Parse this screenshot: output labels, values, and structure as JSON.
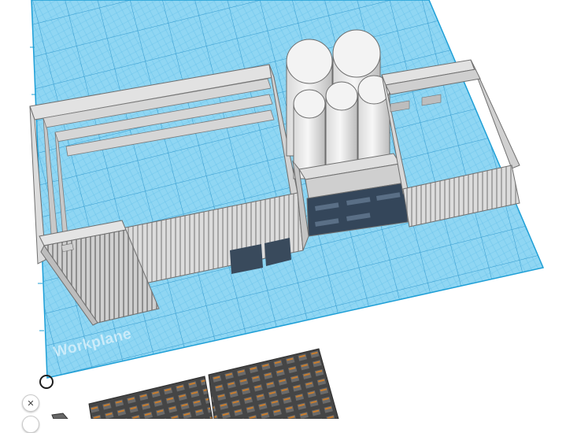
{
  "workplane": {
    "label": "Workplane",
    "grid_color": "#1f9fd6",
    "plane_color": "#8fd6f3"
  },
  "model": {
    "wall_color": "#e6e6e6",
    "shadow_color": "#a9a9a9",
    "dark_color": "#2f3d4e",
    "silo_color": "#efefef"
  },
  "controls": {
    "close_glyph": "✕"
  }
}
